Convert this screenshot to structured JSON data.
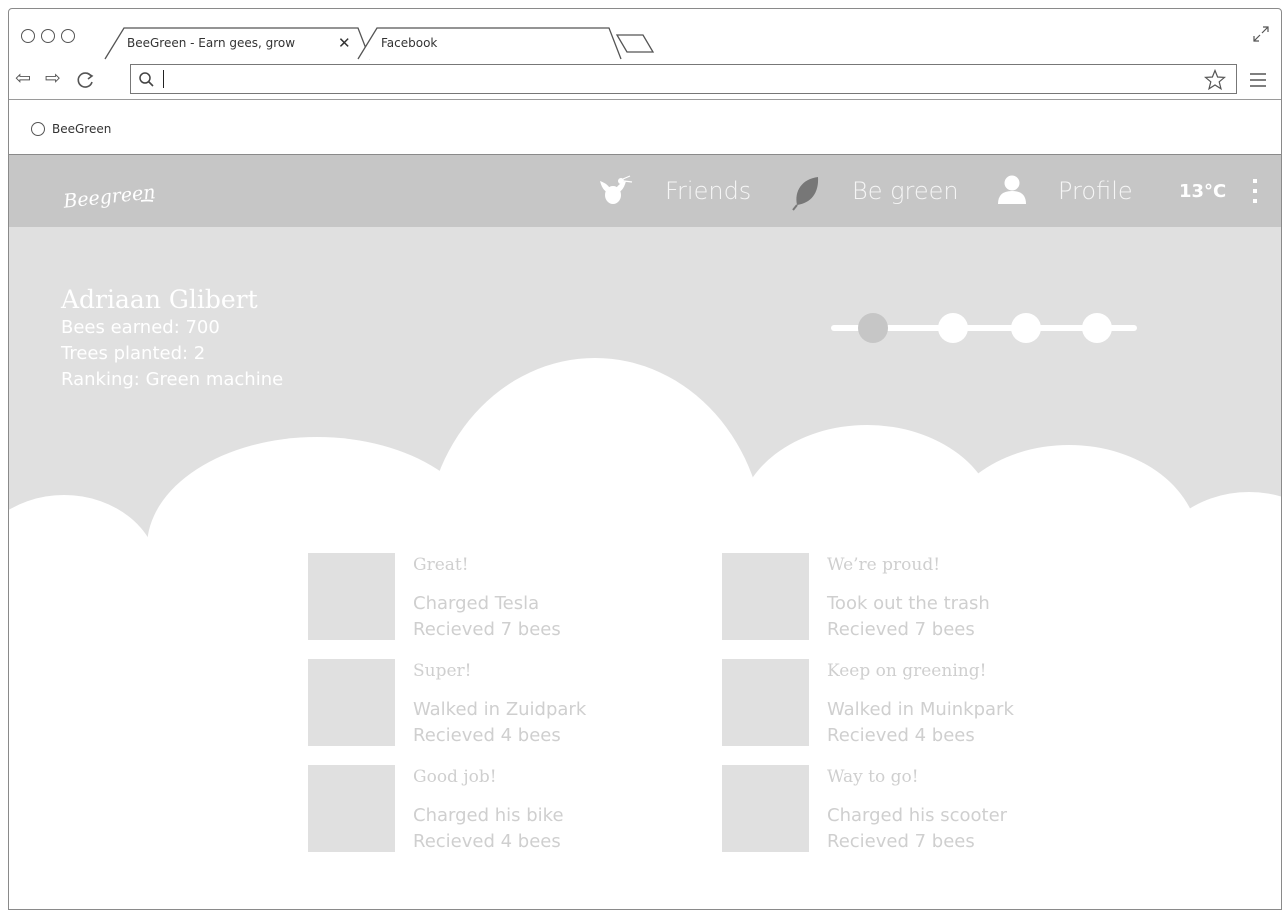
{
  "browser": {
    "tabs": [
      {
        "label": "BeeGreen - Earn gees, grow",
        "active": true
      },
      {
        "label": "Facebook",
        "active": false
      }
    ],
    "url_value": "",
    "bookmark": "BeeGreen"
  },
  "app": {
    "logo_text": "Beegreen",
    "nav": [
      {
        "label": "Friends",
        "icon": "bee-icon"
      },
      {
        "label": "Be green",
        "icon": "leaf-icon"
      },
      {
        "label": "Profile",
        "icon": "person-icon"
      }
    ],
    "temperature": "13°C"
  },
  "user": {
    "name": "Adriaan Glibert",
    "bees_earned": "Bees earned: 700",
    "trees_planted": "Trees planted: 2",
    "ranking": "Ranking: Green machine"
  },
  "progress": {
    "steps": 4,
    "current_step": 1
  },
  "activities": [
    {
      "title": "Great!",
      "action": "Charged Tesla",
      "reward": "Recieved 7 bees"
    },
    {
      "title": "We’re proud!",
      "action": "Took out the trash",
      "reward": "Recieved 7 bees"
    },
    {
      "title": "Super!",
      "action": "Walked in Zuidpark",
      "reward": "Recieved 4 bees"
    },
    {
      "title": "Keep on greening!",
      "action": "Walked in Muinkpark",
      "reward": "Recieved 4 bees"
    },
    {
      "title": "Good job!",
      "action": "Charged his bike",
      "reward": "Recieved 4 bees"
    },
    {
      "title": "Way to go!",
      "action": "Charged his scooter",
      "reward": "Recieved 7 bees"
    }
  ],
  "colors": {
    "nav_bg": "#c6c6c6",
    "page_bg": "#e0e0e0",
    "cloud": "#ffffff",
    "muted_text": "#cfcfcf",
    "step_active": "#c6c6c6"
  }
}
